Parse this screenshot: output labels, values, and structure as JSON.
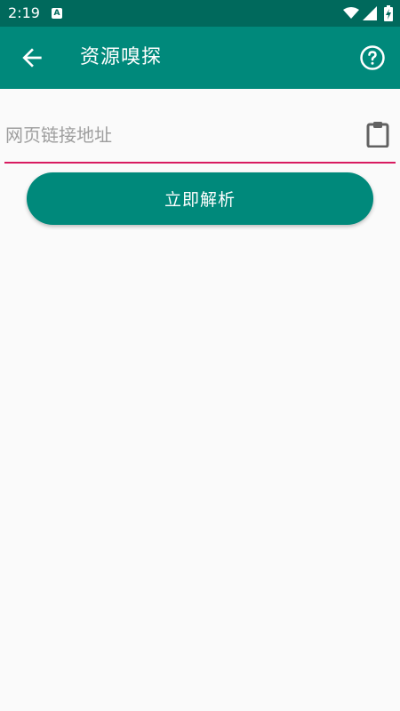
{
  "status_bar": {
    "time": "2:19",
    "notification_glyph": "A"
  },
  "app_bar": {
    "title": "资源嗅探"
  },
  "url_field": {
    "placeholder": "网页链接地址",
    "value": ""
  },
  "parse_button": {
    "label": "立即解析"
  },
  "colors": {
    "status_bar": "#00695c",
    "app_bar": "#00897b",
    "accent_underline": "#d81b60",
    "background": "#fafafa"
  },
  "icons": {
    "back": "arrow-back-icon",
    "help": "help-circle-icon",
    "clipboard": "clipboard-icon",
    "wifi": "wifi-icon",
    "signal": "signal-icon",
    "battery": "battery-charging-icon"
  }
}
